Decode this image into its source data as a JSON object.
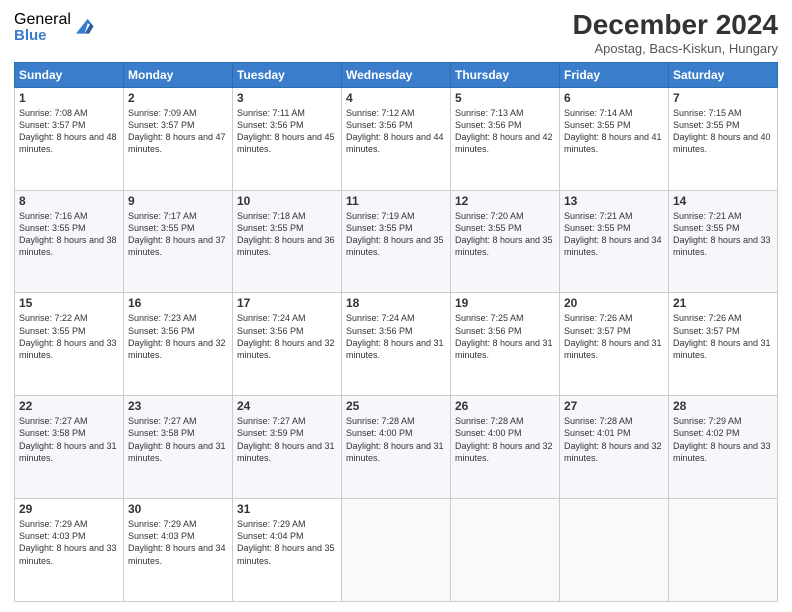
{
  "logo": {
    "general": "General",
    "blue": "Blue"
  },
  "header": {
    "month": "December 2024",
    "location": "Apostag, Bacs-Kiskun, Hungary"
  },
  "weekdays": [
    "Sunday",
    "Monday",
    "Tuesday",
    "Wednesday",
    "Thursday",
    "Friday",
    "Saturday"
  ],
  "weeks": [
    [
      {
        "day": "1",
        "sunrise": "7:08 AM",
        "sunset": "3:57 PM",
        "daylight": "8 hours and 48 minutes."
      },
      {
        "day": "2",
        "sunrise": "7:09 AM",
        "sunset": "3:57 PM",
        "daylight": "8 hours and 47 minutes."
      },
      {
        "day": "3",
        "sunrise": "7:11 AM",
        "sunset": "3:56 PM",
        "daylight": "8 hours and 45 minutes."
      },
      {
        "day": "4",
        "sunrise": "7:12 AM",
        "sunset": "3:56 PM",
        "daylight": "8 hours and 44 minutes."
      },
      {
        "day": "5",
        "sunrise": "7:13 AM",
        "sunset": "3:56 PM",
        "daylight": "8 hours and 42 minutes."
      },
      {
        "day": "6",
        "sunrise": "7:14 AM",
        "sunset": "3:55 PM",
        "daylight": "8 hours and 41 minutes."
      },
      {
        "day": "7",
        "sunrise": "7:15 AM",
        "sunset": "3:55 PM",
        "daylight": "8 hours and 40 minutes."
      }
    ],
    [
      {
        "day": "8",
        "sunrise": "7:16 AM",
        "sunset": "3:55 PM",
        "daylight": "8 hours and 38 minutes."
      },
      {
        "day": "9",
        "sunrise": "7:17 AM",
        "sunset": "3:55 PM",
        "daylight": "8 hours and 37 minutes."
      },
      {
        "day": "10",
        "sunrise": "7:18 AM",
        "sunset": "3:55 PM",
        "daylight": "8 hours and 36 minutes."
      },
      {
        "day": "11",
        "sunrise": "7:19 AM",
        "sunset": "3:55 PM",
        "daylight": "8 hours and 35 minutes."
      },
      {
        "day": "12",
        "sunrise": "7:20 AM",
        "sunset": "3:55 PM",
        "daylight": "8 hours and 35 minutes."
      },
      {
        "day": "13",
        "sunrise": "7:21 AM",
        "sunset": "3:55 PM",
        "daylight": "8 hours and 34 minutes."
      },
      {
        "day": "14",
        "sunrise": "7:21 AM",
        "sunset": "3:55 PM",
        "daylight": "8 hours and 33 minutes."
      }
    ],
    [
      {
        "day": "15",
        "sunrise": "7:22 AM",
        "sunset": "3:55 PM",
        "daylight": "8 hours and 33 minutes."
      },
      {
        "day": "16",
        "sunrise": "7:23 AM",
        "sunset": "3:56 PM",
        "daylight": "8 hours and 32 minutes."
      },
      {
        "day": "17",
        "sunrise": "7:24 AM",
        "sunset": "3:56 PM",
        "daylight": "8 hours and 32 minutes."
      },
      {
        "day": "18",
        "sunrise": "7:24 AM",
        "sunset": "3:56 PM",
        "daylight": "8 hours and 31 minutes."
      },
      {
        "day": "19",
        "sunrise": "7:25 AM",
        "sunset": "3:56 PM",
        "daylight": "8 hours and 31 minutes."
      },
      {
        "day": "20",
        "sunrise": "7:26 AM",
        "sunset": "3:57 PM",
        "daylight": "8 hours and 31 minutes."
      },
      {
        "day": "21",
        "sunrise": "7:26 AM",
        "sunset": "3:57 PM",
        "daylight": "8 hours and 31 minutes."
      }
    ],
    [
      {
        "day": "22",
        "sunrise": "7:27 AM",
        "sunset": "3:58 PM",
        "daylight": "8 hours and 31 minutes."
      },
      {
        "day": "23",
        "sunrise": "7:27 AM",
        "sunset": "3:58 PM",
        "daylight": "8 hours and 31 minutes."
      },
      {
        "day": "24",
        "sunrise": "7:27 AM",
        "sunset": "3:59 PM",
        "daylight": "8 hours and 31 minutes."
      },
      {
        "day": "25",
        "sunrise": "7:28 AM",
        "sunset": "4:00 PM",
        "daylight": "8 hours and 31 minutes."
      },
      {
        "day": "26",
        "sunrise": "7:28 AM",
        "sunset": "4:00 PM",
        "daylight": "8 hours and 32 minutes."
      },
      {
        "day": "27",
        "sunrise": "7:28 AM",
        "sunset": "4:01 PM",
        "daylight": "8 hours and 32 minutes."
      },
      {
        "day": "28",
        "sunrise": "7:29 AM",
        "sunset": "4:02 PM",
        "daylight": "8 hours and 33 minutes."
      }
    ],
    [
      {
        "day": "29",
        "sunrise": "7:29 AM",
        "sunset": "4:03 PM",
        "daylight": "8 hours and 33 minutes."
      },
      {
        "day": "30",
        "sunrise": "7:29 AM",
        "sunset": "4:03 PM",
        "daylight": "8 hours and 34 minutes."
      },
      {
        "day": "31",
        "sunrise": "7:29 AM",
        "sunset": "4:04 PM",
        "daylight": "8 hours and 35 minutes."
      },
      null,
      null,
      null,
      null
    ]
  ],
  "labels": {
    "sunrise": "Sunrise:",
    "sunset": "Sunset:",
    "daylight": "Daylight:"
  }
}
